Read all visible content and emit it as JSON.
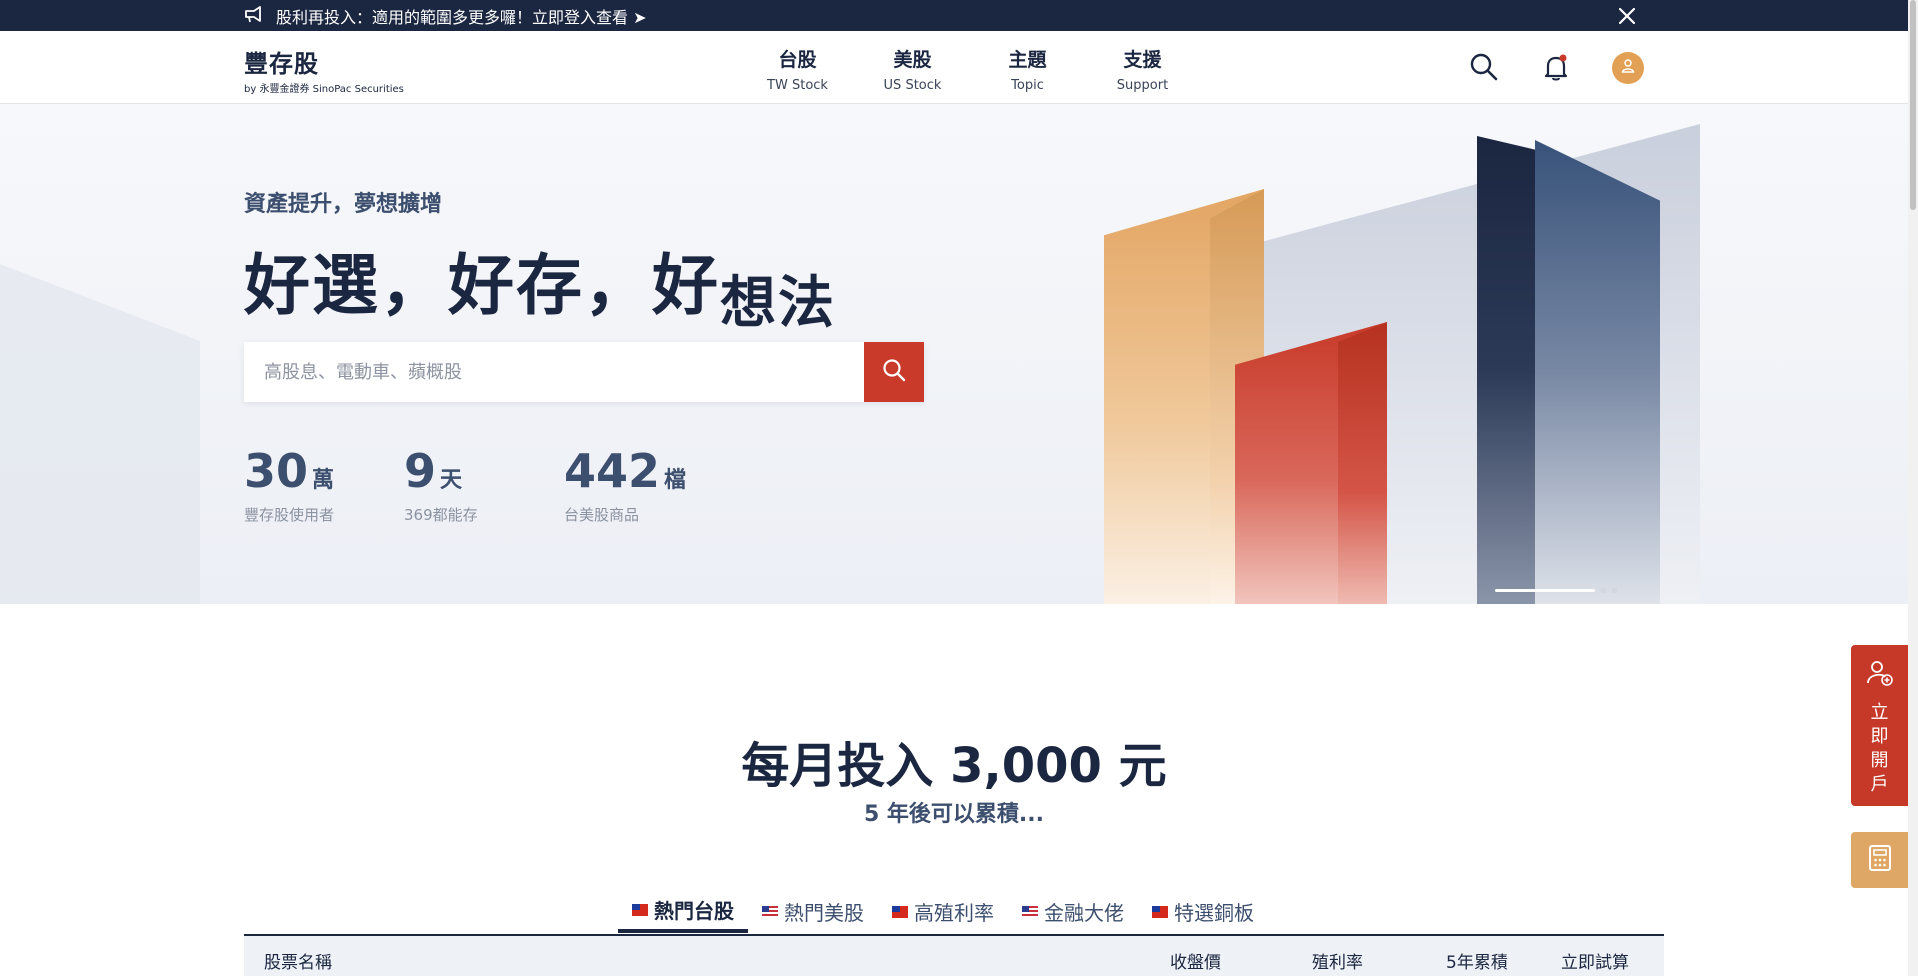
{
  "announcement": {
    "text": "股利再投入：適用的範圍多更多囉！立即登入查看 ➤",
    "icon": "megaphone-icon",
    "close_icon": "close-icon"
  },
  "header": {
    "brand": "豐存股",
    "brand_sub": "by 永豐金證券 SinoPac Securities",
    "nav": [
      {
        "zh": "台股",
        "en": "TW Stock"
      },
      {
        "zh": "美股",
        "en": "US Stock"
      },
      {
        "zh": "主題",
        "en": "Topic"
      },
      {
        "zh": "支援",
        "en": "Support"
      }
    ],
    "icons": [
      "search-icon",
      "bell-icon",
      "user-icon"
    ]
  },
  "hero": {
    "tagline": "資產提升，夢想擴增",
    "headline_main": "好選，好存，好",
    "headline_small": "想法",
    "search_placeholder": "高股息、電動車、蘋概股",
    "stats": [
      {
        "num": "30",
        "unit": "萬",
        "label": "豐存股使用者"
      },
      {
        "num": "9",
        "unit": "天",
        "label": "369都能存"
      },
      {
        "num": "442",
        "unit": "檔",
        "label": "台美股商品"
      }
    ],
    "slides": {
      "count": 3,
      "active": 1
    }
  },
  "section": {
    "title": "每月投入 3,000 元",
    "subtitle": "5 年後可以累積...",
    "tabs": [
      {
        "label": "熱門台股",
        "flag": "tw",
        "active": true
      },
      {
        "label": "熱門美股",
        "flag": "us",
        "active": false
      },
      {
        "label": "高殖利率",
        "flag": "tw",
        "active": false
      },
      {
        "label": "金融大佬",
        "flag": "us",
        "active": false
      },
      {
        "label": "特選銅板",
        "flag": "tw",
        "active": false
      }
    ],
    "table_headers": [
      "股票名稱",
      "收盤價",
      "殖利率",
      "5年累積",
      "立即試算"
    ]
  },
  "side": {
    "open_account": "立即開戶",
    "calc_icon": "calculator-icon"
  },
  "colors": {
    "navy": "#1b2640",
    "accent_red": "#c93a2a",
    "accent_gold": "#e1a053"
  }
}
